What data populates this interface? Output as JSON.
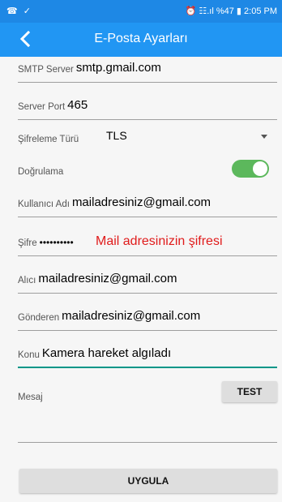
{
  "status": {
    "left_icons": "☎ ✓",
    "right_text": "⏰ ☷.ıl %47 ▮ 2:05 PM"
  },
  "appbar": {
    "back_icon": "back-arrow-icon",
    "title": "E-Posta Ayarları"
  },
  "form": {
    "smtp": {
      "label": "SMTP Server",
      "value": "smtp.gmail.com"
    },
    "port": {
      "label": "Server Port",
      "value": "465"
    },
    "encryption": {
      "label": "Şifreleme Türü",
      "value": "TLS"
    },
    "auth": {
      "label": "Doğrulama",
      "enabled": true
    },
    "username": {
      "label": "Kullanıcı Adı",
      "value": "mailadresiniz@gmail.com"
    },
    "password": {
      "label": "Şifre",
      "masked": "••••••••••",
      "annotation": "Mail adresinizin şifresi"
    },
    "recipient": {
      "label": "Alıcı",
      "value": "mailadresiniz@gmail.com"
    },
    "sender": {
      "label": "Gönderen",
      "value": "mailadresiniz@gmail.com"
    },
    "subject": {
      "label": "Konu",
      "value": "Kamera hareket algıladı"
    },
    "message": {
      "label": "Mesaj",
      "value": ""
    }
  },
  "buttons": {
    "test": "TEST",
    "apply": "UYGULA"
  },
  "colors": {
    "statusbar": "#1e88e5",
    "appbar": "#2196f3",
    "toggle_on": "#5cb85c",
    "active_underline": "#009688",
    "annotation": "#e01b1b"
  }
}
